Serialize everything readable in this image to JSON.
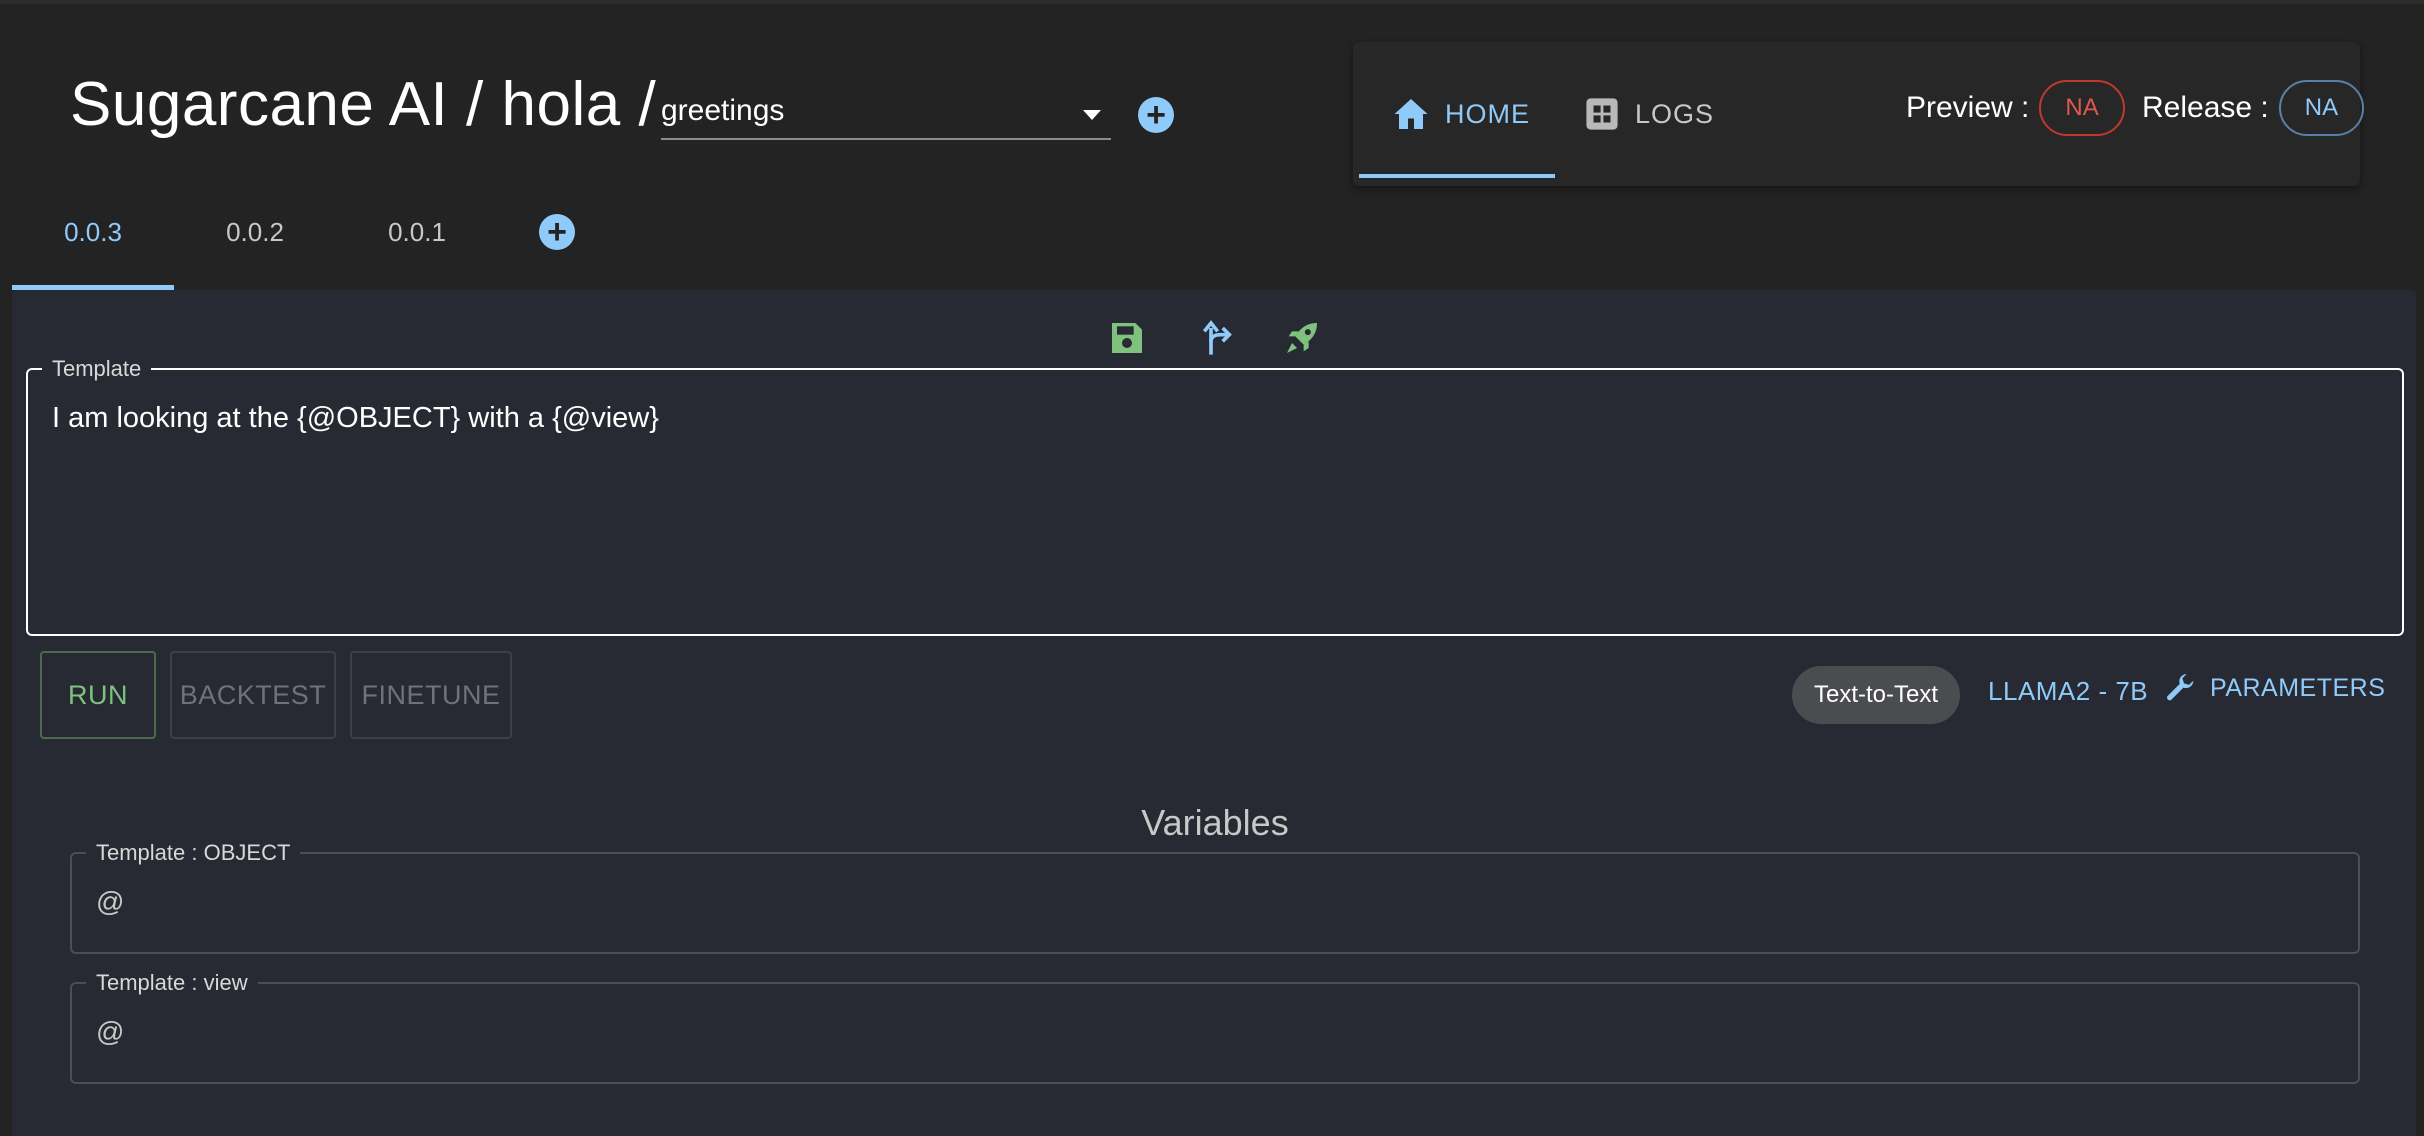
{
  "header": {
    "org": "Sugarcane AI",
    "separator": "/",
    "project": "hola",
    "task_select": {
      "value": "greetings"
    }
  },
  "nav": {
    "tabs": [
      {
        "label": "HOME",
        "icon": "home-icon",
        "active": true
      },
      {
        "label": "LOGS",
        "icon": "dashboard-icon",
        "active": false
      }
    ],
    "preview": {
      "label": "Preview :",
      "value": "NA",
      "color": "#e0574c"
    },
    "release": {
      "label": "Release :",
      "value": "NA",
      "color": "#90caf9"
    }
  },
  "versions": {
    "tabs": [
      "0.0.3",
      "0.0.2",
      "0.0.1"
    ],
    "active": "0.0.3"
  },
  "toolbar": {
    "icons": [
      "save-icon",
      "fork-icon",
      "rocket-icon"
    ]
  },
  "template": {
    "legend": "Template",
    "text": "I am looking at the {@OBJECT} with a {@view}"
  },
  "actions": {
    "run": "RUN",
    "backtest": "BACKTEST",
    "finetune": "FINETUNE"
  },
  "model": {
    "mode": "Text-to-Text",
    "name": "LLAMA2 - 7B",
    "parameters_label": "PARAMETERS"
  },
  "variables": {
    "heading": "Variables",
    "fields": [
      {
        "label": "Template : OBJECT",
        "prefix": "@",
        "value": ""
      },
      {
        "label": "Template : view",
        "prefix": "@",
        "value": ""
      }
    ]
  },
  "colors": {
    "accent": "#90caf9",
    "success": "#7ec27e",
    "danger": "#e0574c",
    "background": "#232323",
    "card": "#272a32"
  }
}
